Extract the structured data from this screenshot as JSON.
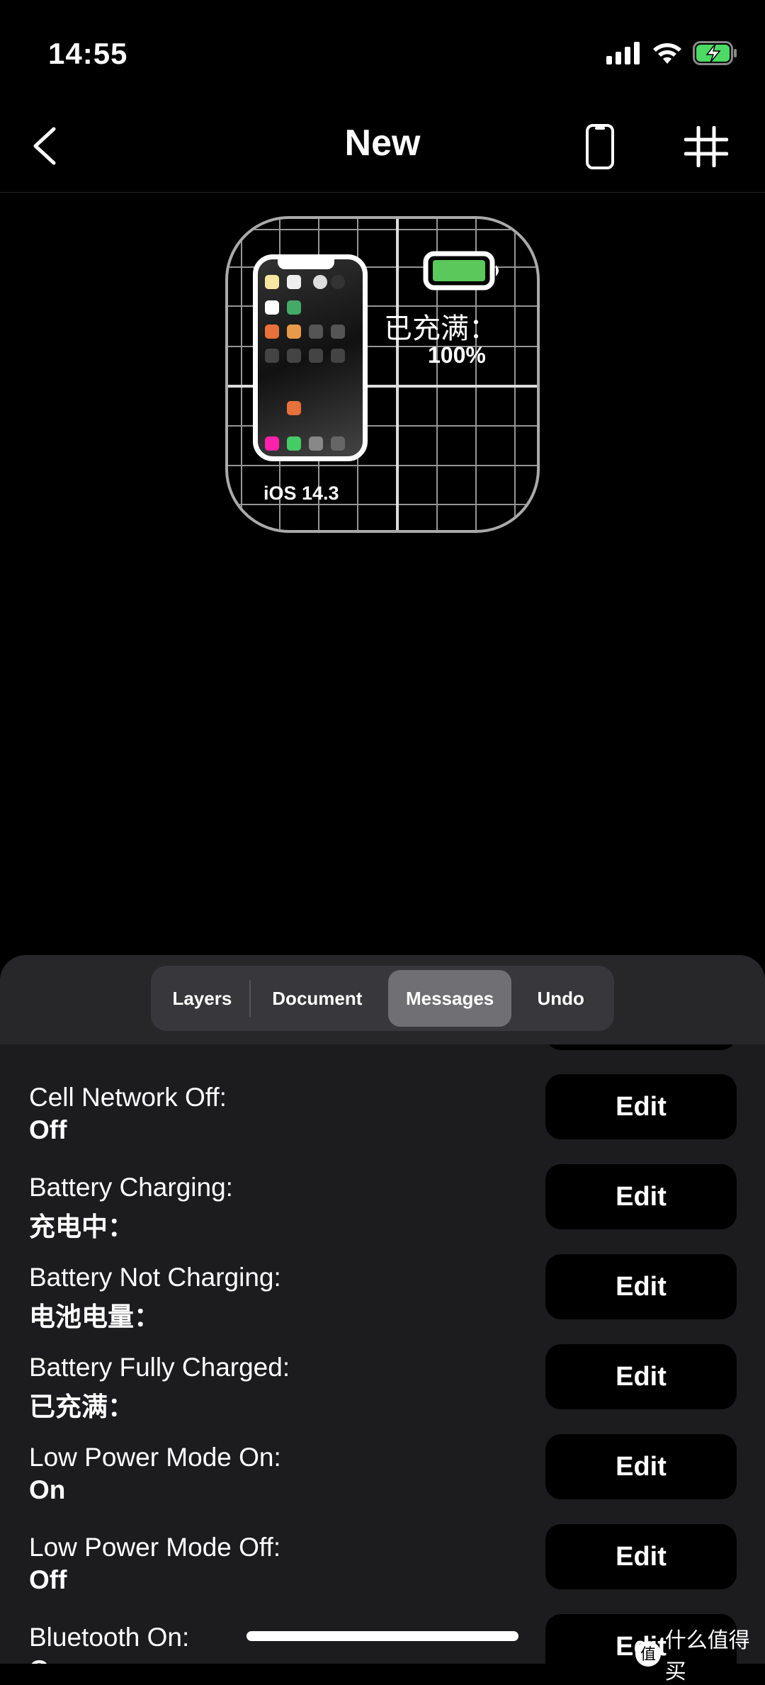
{
  "status_bar": {
    "time": "14:55",
    "battery_color": "#4cd964"
  },
  "nav": {
    "title": "New",
    "back_icon": "chevron-left-icon",
    "device_icon": "iphone-icon",
    "grid_icon": "grid-icon"
  },
  "widget": {
    "os_version": "iOS 14.3",
    "battery_label": "已充满：",
    "battery_percent": "100%",
    "battery_level": 1.0,
    "battery_fill": "#5ac85a"
  },
  "tabs": [
    {
      "label": "Layers"
    },
    {
      "label": "Document"
    },
    {
      "label": "Messages",
      "active": true
    },
    {
      "label": "Undo"
    }
  ],
  "rows": [
    {
      "label": "Cell Network Off:",
      "value": "Off",
      "button": "Edit"
    },
    {
      "label": "Battery Charging:",
      "value": "充电中：",
      "button": "Edit"
    },
    {
      "label": "Battery Not Charging:",
      "value": "电池电量：",
      "button": "Edit"
    },
    {
      "label": "Battery Fully Charged:",
      "value": "已充满：",
      "button": "Edit"
    },
    {
      "label": "Low Power Mode On:",
      "value": "On",
      "button": "Edit"
    },
    {
      "label": "Low Power Mode Off:",
      "value": "Off",
      "button": "Edit"
    },
    {
      "label": "Bluetooth On:",
      "value": "On",
      "button": "Edit"
    }
  ],
  "watermark": "什么值得买"
}
